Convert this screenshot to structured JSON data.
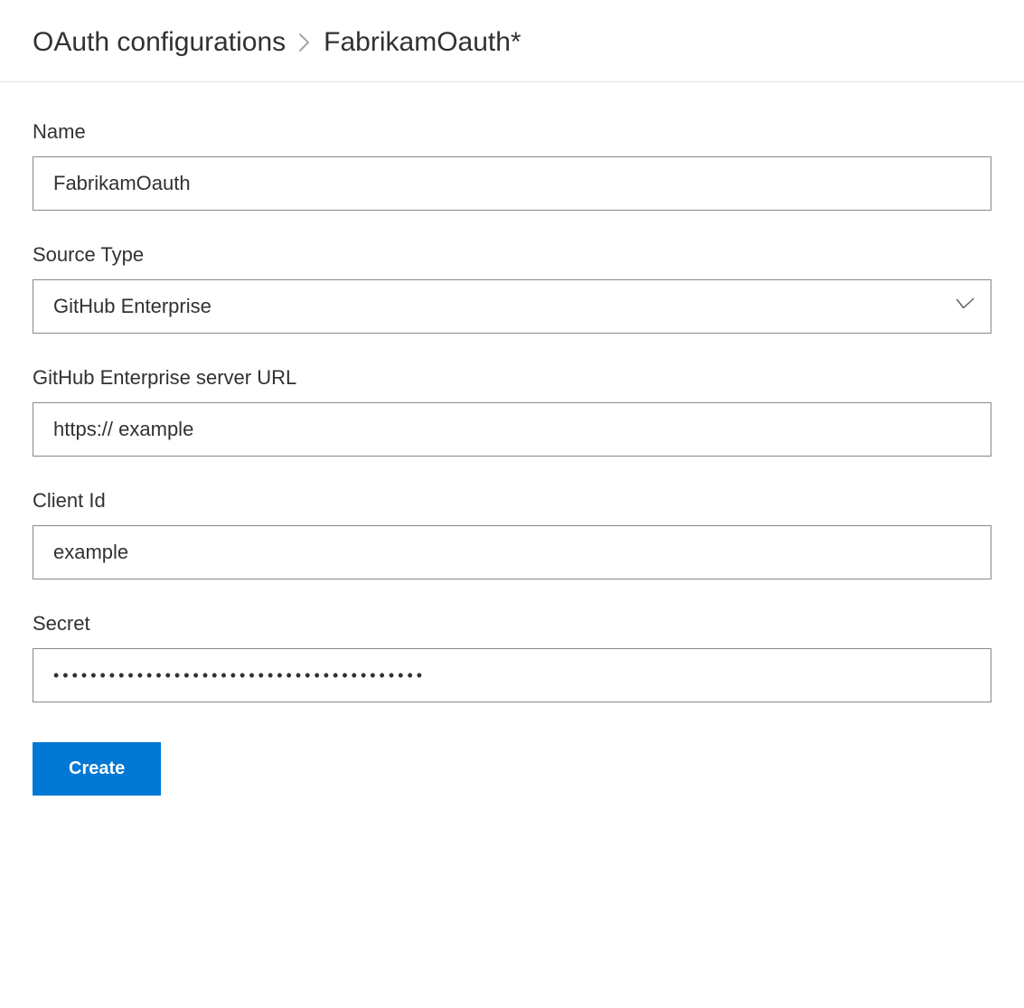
{
  "breadcrumb": {
    "parent": "OAuth configurations",
    "current": "FabrikamOauth*"
  },
  "form": {
    "name": {
      "label": "Name",
      "value": "FabrikamOauth"
    },
    "source_type": {
      "label": "Source Type",
      "value": "GitHub Enterprise"
    },
    "server_url": {
      "label": "GitHub Enterprise server URL",
      "value": "https:// example"
    },
    "client_id": {
      "label": "Client Id",
      "value": "example"
    },
    "secret": {
      "label": "Secret",
      "value": "••••••••••••••••••••••••••••••••••••••••"
    },
    "create_button": "Create"
  }
}
